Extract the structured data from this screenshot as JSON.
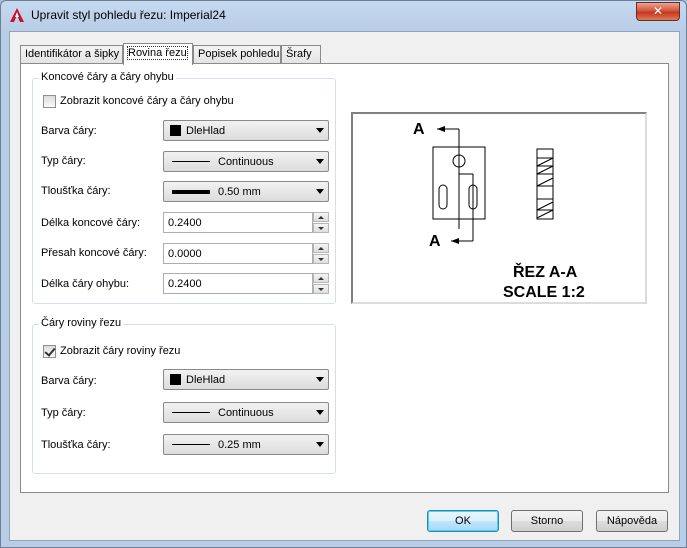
{
  "window": {
    "title": "Upravit styl pohledu řezu: Imperial24",
    "close_glyph": "✕"
  },
  "tabs": [
    {
      "label": "Identifikátor a šipky",
      "active": false
    },
    {
      "label": "Rovina řezu",
      "active": true
    },
    {
      "label": "Popisek pohledu",
      "active": false
    },
    {
      "label": "Šrafy",
      "active": false
    }
  ],
  "end_lines_group": {
    "title": "Koncové čáry a čáry ohybu",
    "show_checkbox": {
      "label": "Zobrazit koncové čáry a čáry ohybu",
      "checked": false
    },
    "line_color": {
      "label": "Barva čáry:",
      "value": "DleHlad"
    },
    "line_type": {
      "label": "Typ čáry:",
      "value": "Continuous"
    },
    "line_weight": {
      "label": "Tloušťka čáry:",
      "value": "0.50 mm"
    },
    "end_line_length": {
      "label": "Délka koncové čáry:",
      "value": "0.2400"
    },
    "end_line_overshoot": {
      "label": "Přesah koncové čáry:",
      "value": "0.0000"
    },
    "bend_line_length": {
      "label": "Délka čáry ohybu:",
      "value": "0.2400"
    }
  },
  "cutting_plane_group": {
    "title": "Čáry roviny řezu",
    "show_checkbox": {
      "label": "Zobrazit čáry roviny řezu",
      "checked": true
    },
    "line_color": {
      "label": "Barva čáry:",
      "value": "DleHlad"
    },
    "line_type": {
      "label": "Typ čáry:",
      "value": "Continuous"
    },
    "line_weight": {
      "label": "Tloušťka čáry:",
      "value": "0.25 mm"
    }
  },
  "preview": {
    "label_top": "A",
    "label_bottom": "A",
    "section_title": "ŘEZ A-A",
    "scale_text": "SCALE 1:2"
  },
  "buttons": {
    "ok": "OK",
    "cancel": "Storno",
    "help": "Nápověda"
  },
  "colors": {
    "title_bar": "#b9cee6",
    "close_button": "#c4371d",
    "default_button_border": "#3c7fb1",
    "app_icon": "#c8102e"
  }
}
